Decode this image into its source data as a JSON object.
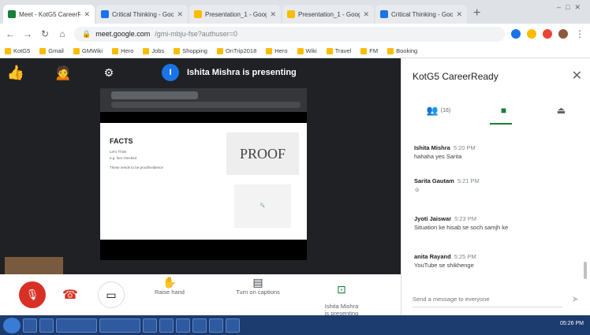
{
  "browser": {
    "tabs": [
      {
        "label": "Meet - KotG5 CareerReady",
        "active": true,
        "color": "#188038"
      },
      {
        "label": "Critical Thinking - Google",
        "active": false,
        "color": "#1a73e8"
      },
      {
        "label": "Presentation_1 - Google Slides",
        "active": false,
        "color": "#fbbc04"
      },
      {
        "label": "Presentation_1 - Google Slides",
        "active": false,
        "color": "#fbbc04"
      },
      {
        "label": "Critical Thinking - Google",
        "active": false,
        "color": "#1a73e8"
      }
    ],
    "new_tab": "+",
    "url_host": "meet.google.com",
    "url_path": "/gmi-mbju-fse?authuser=0",
    "bookmarks": [
      "KotG5",
      "Gmail",
      "GMWiki",
      "Hero",
      "Jobs",
      "Shopping",
      "OnTrip2018",
      "Hero",
      "Wiki",
      "Travel",
      "FM",
      "Booking"
    ]
  },
  "meet": {
    "presenting_initial": "I",
    "presenting_text": "Ishita Mishra is presenting",
    "slide": {
      "title": "FACTS",
      "lines": [
        "Let's Think",
        "e.g. fact checked",
        "These needs to be proof/evidence"
      ],
      "image_word": "PROOF"
    },
    "controls": {
      "raise_hand": "Raise hand",
      "captions": "Turn on captions",
      "presenting": "Ishita Mishra\nis presenting"
    }
  },
  "chat": {
    "title": "KotG5 CareerReady",
    "people_count": "(16)",
    "messages": [
      {
        "who": "Ishita Mishra",
        "time": "5:20 PM",
        "text": "hahaha yes Sarita"
      },
      {
        "who": "Sarita Gautam",
        "time": "5:21 PM",
        "text": "☺"
      },
      {
        "who": "Jyoti Jaiswar",
        "time": "5:23 PM",
        "text": "Situation ke hisab se soch samjh ke"
      },
      {
        "who": "anita Rayand",
        "time": "5:25 PM",
        "text": "YouTube se shikhenge"
      }
    ],
    "input_placeholder": "Send a message to everyone"
  },
  "taskbar": {
    "clock": "05:26 PM"
  },
  "colors": {
    "meet_bg": "#202124",
    "hangup": "#d93025",
    "accent_green": "#188038",
    "presenter_blue": "#1a73e8"
  }
}
